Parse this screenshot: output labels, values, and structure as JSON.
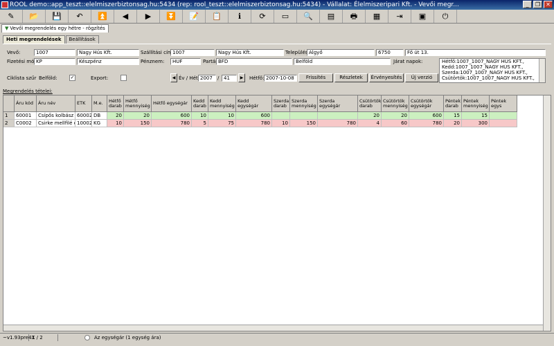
{
  "window": {
    "title": "ROOL demo::app_teszt::elelmiszerbiztonsag.hu:5434 (rep: rool_teszt::elelmiszerbiztonsag.hu:5434) - Vállalat: Élelmiszeripari Kft. - Vevői megr...",
    "btn_min": "_",
    "btn_max": "❐",
    "btn_close": "✕"
  },
  "toolbar": {
    "icons": [
      "edit-icon",
      "open-icon",
      "save-icon",
      "undo-icon",
      "first-icon",
      "prev-icon",
      "next-icon",
      "last-icon",
      "note-icon",
      "copy-icon",
      "info-icon",
      "refresh-icon",
      "window-icon",
      "search-icon",
      "form-icon",
      "print-icon",
      "grid-icon",
      "export-icon",
      "calendar-icon",
      "exit-icon"
    ],
    "glyphs": [
      "✎",
      "📂",
      "💾",
      "↶",
      "⏫",
      "◀",
      "▶",
      "⏬",
      "📝",
      "📋",
      "ℹ",
      "⟳",
      "▭",
      "🔍",
      "▤",
      "🖶",
      "▦",
      "⇥",
      "▣",
      "⏻"
    ]
  },
  "doc_tab": "Vevői megrendelés egy hétre - rögzítés",
  "tabs": [
    "Heti megrendelések",
    "Beállítások"
  ],
  "form": {
    "vevo_label": "Vevő:",
    "vevo_code": "1007",
    "vevo_name": "Nagy Hús Kft.",
    "szallitasi_label": "Szállítási cím:",
    "szallitasi_code": "1007",
    "szallitasi_name": "Nagy Hús Kft.",
    "telepules_label": "Település:",
    "telepules": "Algyő",
    "irsz": "6750",
    "utca": "Fő út 13.",
    "fizetesi_label": "Fizetési mód:",
    "fizetesi_code": "KP",
    "fizetesi_name": "Készpénz",
    "penznem_label": "Pénznem:",
    "penznem": "HUF",
    "partas_label": "Partás:",
    "partas": "BFD",
    "partas_name": "Belföld",
    "jarat_label": "Járat napok:",
    "ciklista_label": "Ciklista szűr",
    "belfold_label": "Belföld:",
    "belfold_check": "✓",
    "export_label": "Export:",
    "ev_het_label": "Év / Hét:",
    "ev": "2007",
    "het": "41",
    "hetfo_label": "Hétfő:",
    "hetfo": "2007-10-08",
    "btn_frissites": "Frissítés",
    "btn_reszletek": "Részletek",
    "btn_ervenyesites": "Érvényesítés",
    "btn_uj": "Új verzió",
    "nav_prev": "◀",
    "nav_next": "▶"
  },
  "jarat_napok": [
    "Hétfő:1007_1007_NAGY HÚS KFT.,",
    "Kedd:1007_1007_NAGY HÚS KFT.,",
    "Szerda:1007_1007_NAGY HÚS KFT.,",
    "Csütörtök:1007_1007_NAGY HÚS KFT.,"
  ],
  "grid": {
    "section_label": "Megrendelés tételei:",
    "headers": [
      "",
      "Áru kód",
      "Áru név",
      "ETK",
      "M.e.",
      "Hétfő darab",
      "Hétfő mennyiség",
      "Hétfő egységár",
      "Kedd darab",
      "Kedd mennyiség",
      "Kedd egységár",
      "Szerda darab",
      "Szerda mennyiség",
      "Szerda egységár",
      "Csütörtök darab",
      "Csütörtök mennyiség",
      "Csütörtök egységár",
      "Péntek darab",
      "Péntek mennyiség",
      "Péntek egys"
    ],
    "rows": [
      [
        "1",
        "60001",
        "Csípős kolbász",
        "60002",
        "DB",
        "20",
        "20",
        "600",
        "10",
        "10",
        "600",
        "",
        "",
        "",
        "20",
        "20",
        "600",
        "15",
        "15",
        ""
      ],
      [
        "2",
        "C0002",
        "Csirke mellfilé eh.",
        "10002",
        "KG",
        "10",
        "150",
        "780",
        "5",
        "75",
        "780",
        "10",
        "150",
        "780",
        "4",
        "60",
        "780",
        "20",
        "300",
        ""
      ]
    ],
    "row_colors": [
      "#ccf0c0",
      "#f7c8c8"
    ]
  },
  "status": {
    "version": "~v1.93pre4X",
    "records": "1 / 2",
    "unit_price": "Az egységár (1 egység ára)"
  }
}
